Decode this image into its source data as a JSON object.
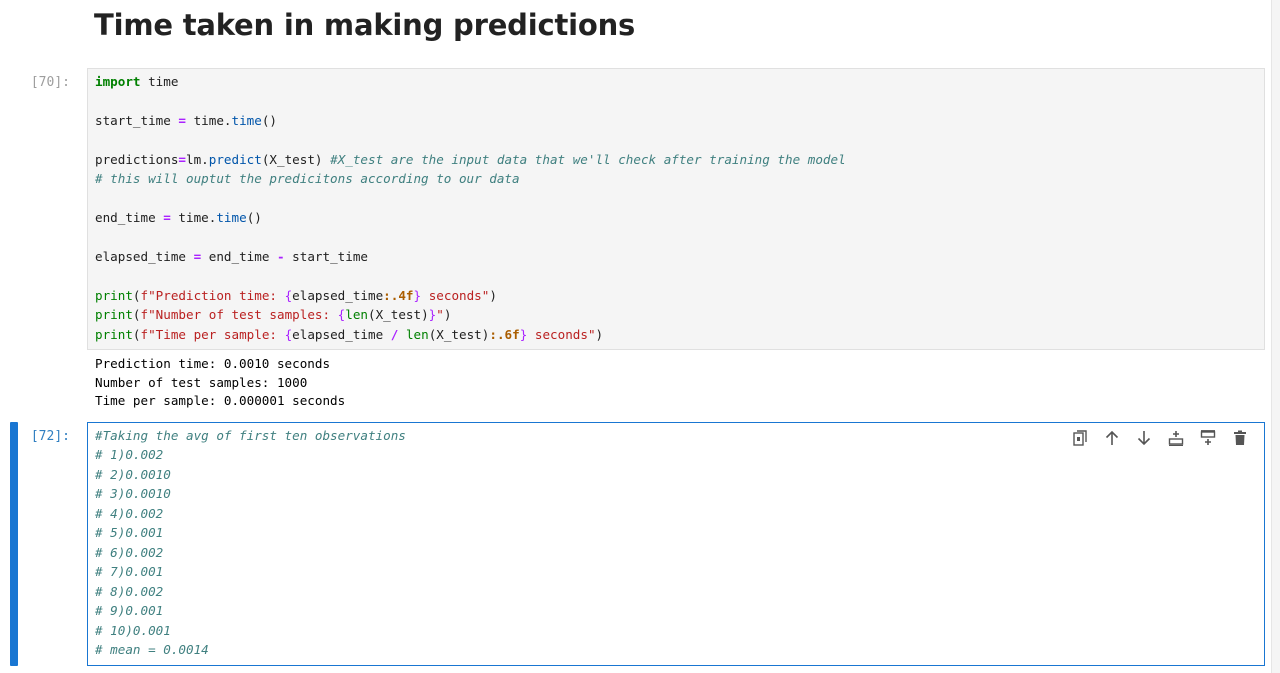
{
  "heading": "Time taken in making predictions",
  "cells": [
    {
      "prompt": "[70]:",
      "lines": [
        [
          [
            "kw",
            "import"
          ],
          [
            "t",
            " time"
          ]
        ],
        [],
        [
          [
            "t",
            "start_time "
          ],
          [
            "op",
            "="
          ],
          [
            "t",
            " time."
          ],
          [
            "fn",
            "time"
          ],
          [
            "t",
            "()"
          ]
        ],
        [],
        [
          [
            "t",
            "predictions"
          ],
          [
            "op",
            "="
          ],
          [
            "t",
            "lm."
          ],
          [
            "fn",
            "predict"
          ],
          [
            "t",
            "(X_test) "
          ],
          [
            "cm",
            "#X_test are the input data that we'll check after training the model"
          ]
        ],
        [
          [
            "cm",
            "# this will ouptut the predicitons according to our data"
          ]
        ],
        [],
        [
          [
            "t",
            "end_time "
          ],
          [
            "op",
            "="
          ],
          [
            "t",
            " time."
          ],
          [
            "fn",
            "time"
          ],
          [
            "t",
            "()"
          ]
        ],
        [],
        [
          [
            "t",
            "elapsed_time "
          ],
          [
            "op",
            "="
          ],
          [
            "t",
            " end_time "
          ],
          [
            "op",
            "-"
          ],
          [
            "t",
            " start_time"
          ]
        ],
        [],
        [
          [
            "bi",
            "print"
          ],
          [
            "t",
            "("
          ],
          [
            "str",
            "f\"Prediction time: "
          ],
          [
            "brace",
            "{"
          ],
          [
            "t",
            "elapsed_time"
          ],
          [
            "fmt",
            ":.4f"
          ],
          [
            "brace",
            "}"
          ],
          [
            "str",
            " seconds\""
          ],
          [
            "t",
            ")"
          ]
        ],
        [
          [
            "bi",
            "print"
          ],
          [
            "t",
            "("
          ],
          [
            "str",
            "f\"Number of test samples: "
          ],
          [
            "brace",
            "{"
          ],
          [
            "bi",
            "len"
          ],
          [
            "t",
            "(X_test)"
          ],
          [
            "brace",
            "}"
          ],
          [
            "str",
            "\""
          ],
          [
            "t",
            ")"
          ]
        ],
        [
          [
            "bi",
            "print"
          ],
          [
            "t",
            "("
          ],
          [
            "str",
            "f\"Time per sample: "
          ],
          [
            "brace",
            "{"
          ],
          [
            "t",
            "elapsed_time "
          ],
          [
            "op",
            "/"
          ],
          [
            "t",
            " "
          ],
          [
            "bi",
            "len"
          ],
          [
            "t",
            "(X_test)"
          ],
          [
            "fmt",
            ":.6f"
          ],
          [
            "brace",
            "}"
          ],
          [
            "str",
            " seconds\""
          ],
          [
            "t",
            ")"
          ]
        ]
      ],
      "output": [
        "Prediction time: 0.0010 seconds",
        "Number of test samples: 1000",
        "Time per sample: 0.000001 seconds"
      ]
    },
    {
      "prompt": "[72]:",
      "lines": [
        [
          [
            "cm",
            "#Taking the avg of first ten observations"
          ]
        ],
        [
          [
            "cm",
            "# 1)0.002"
          ]
        ],
        [
          [
            "cm",
            "# 2)0.0010"
          ]
        ],
        [
          [
            "cm",
            "# 3)0.0010"
          ]
        ],
        [
          [
            "cm",
            "# 4)0.002"
          ]
        ],
        [
          [
            "cm",
            "# 5)0.001"
          ]
        ],
        [
          [
            "cm",
            "# 6)0.002"
          ]
        ],
        [
          [
            "cm",
            "# 7)0.001"
          ]
        ],
        [
          [
            "cm",
            "# 8)0.002"
          ]
        ],
        [
          [
            "cm",
            "# 9)0.001"
          ]
        ],
        [
          [
            "cm",
            "# 10)0.001"
          ]
        ],
        [
          [
            "cm",
            "# mean = 0.0014"
          ]
        ]
      ]
    }
  ],
  "toolbar": {
    "icons": [
      "duplicate-icon",
      "move-up-icon",
      "move-down-icon",
      "insert-above-icon",
      "insert-below-icon",
      "delete-icon"
    ]
  },
  "colors": {
    "accent": "#1976d2",
    "keyword": "#008000",
    "operator": "#aa22ff",
    "string": "#ba2121",
    "comment": "#408080"
  }
}
